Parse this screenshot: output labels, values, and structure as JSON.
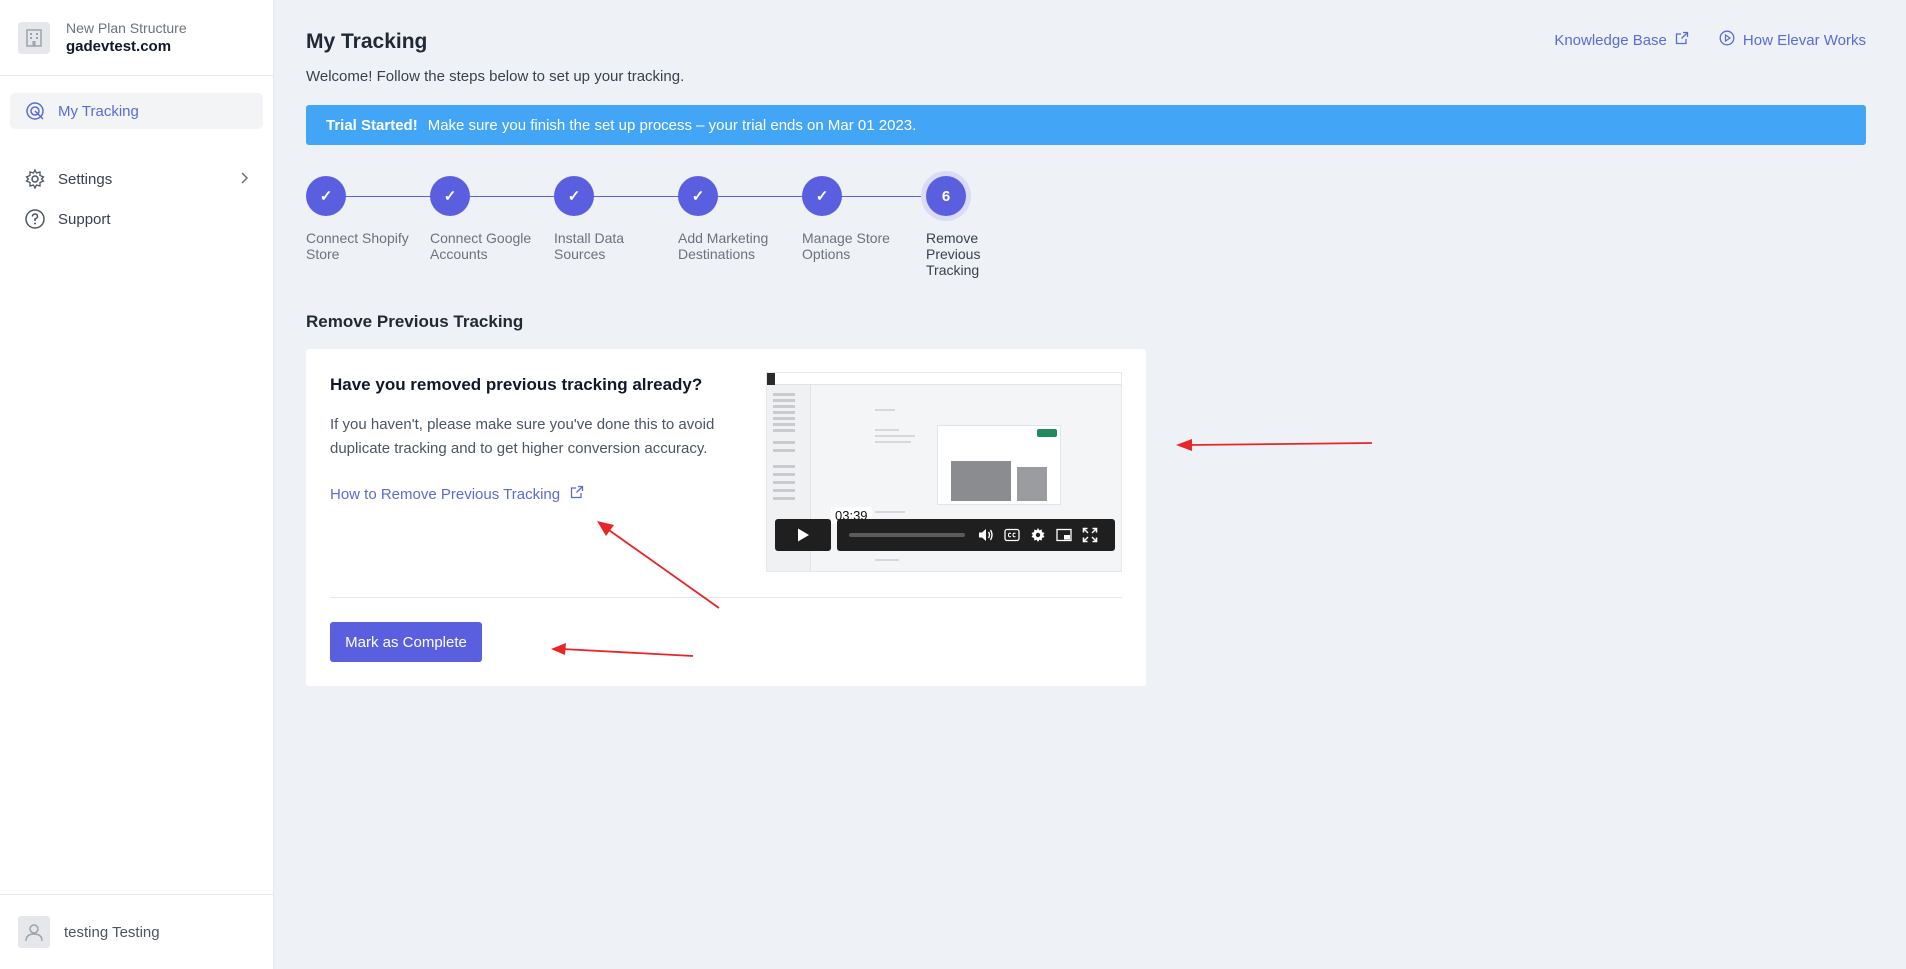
{
  "sidebar": {
    "org": {
      "plan": "New Plan Structure",
      "domain": "gadevtest.com"
    },
    "items": [
      {
        "label": "My Tracking",
        "active": true,
        "icon": "tracking-icon"
      },
      {
        "label": "Settings",
        "icon": "gear-icon",
        "has_chevron": true
      },
      {
        "label": "Support",
        "icon": "help-circle-icon"
      }
    ],
    "user": {
      "name": "testing Testing"
    }
  },
  "header": {
    "title": "My Tracking",
    "subtitle": "Welcome! Follow the steps below to set up your tracking.",
    "links": [
      {
        "label": "Knowledge Base",
        "icon": "external-link-icon"
      },
      {
        "label": "How Elevar Works",
        "icon": "play-circle-icon"
      }
    ]
  },
  "banner": {
    "strong": "Trial Started!",
    "text": "Make sure you finish the set up process – your trial ends on Mar 01 2023.",
    "color": "#42a5f5"
  },
  "steps": [
    {
      "label": "Connect Shopify Store",
      "state": "done",
      "mark": "✓"
    },
    {
      "label": "Connect Google Accounts",
      "state": "done",
      "mark": "✓"
    },
    {
      "label": "Install Data Sources",
      "state": "done",
      "mark": "✓"
    },
    {
      "label": "Add Marketing Destinations",
      "state": "done",
      "mark": "✓"
    },
    {
      "label": "Manage Store Options",
      "state": "done",
      "mark": "✓"
    },
    {
      "label": "Remove Previous Tracking",
      "state": "current",
      "mark": "6"
    }
  ],
  "section": {
    "title": "Remove Previous Tracking",
    "card": {
      "heading": "Have you removed previous tracking already?",
      "description": "If you haven't, please make sure you've done this to avoid duplicate tracking and to get higher conversion accuracy.",
      "link_label": "How to Remove Previous Tracking",
      "button_label": "Mark as Complete",
      "video": {
        "duration": "03:39"
      }
    }
  },
  "colors": {
    "accent": "#5a5fe0",
    "link": "#5a6bd6",
    "annotation": "#e8262a"
  }
}
